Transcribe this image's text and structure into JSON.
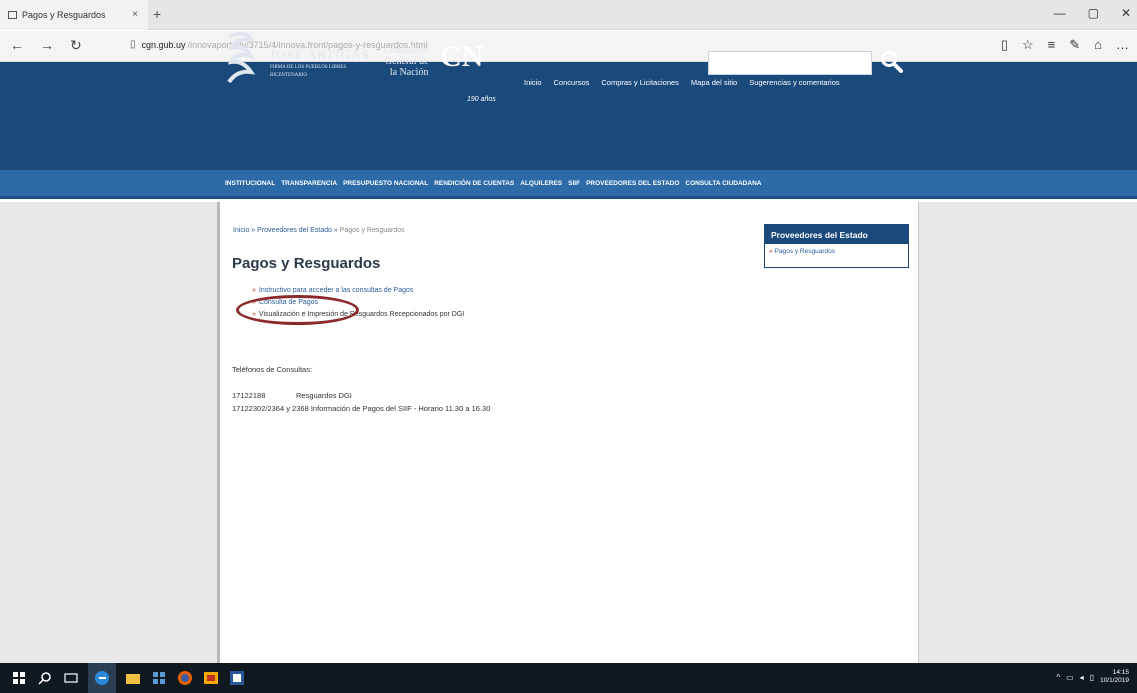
{
  "browser": {
    "tab_title": "Pagos y Resguardos",
    "tab_close": "×",
    "new_tab": "+",
    "url_host": "cgn.gub.uy",
    "url_path": "/innovaportal/v/3715/4/innova.front/pagos-y-resguardos.html"
  },
  "header": {
    "top_links": [
      "Inicio",
      "Concursos",
      "Compras y Licitaciones",
      "Mapa del sitio",
      "Sugerencias y comentarios"
    ],
    "artigas_name": "JOSÉ ARTIGAS",
    "artigas_sub1": "FIRMA DE LOS PUEBLOS LIBRES",
    "artigas_sub2": "BICENTENARIO",
    "cgn_line1": "Contaduría",
    "cgn_line2": "General de",
    "cgn_line3": "la Nación",
    "cgn_logo": "CN",
    "anos": "190 años",
    "search_value": ""
  },
  "mainnav": [
    "INSTITUCIONAL",
    "TRANSPARENCIA",
    "PRESUPUESTO NACIONAL",
    "RENDICIÓN DE CUENTAS",
    "ALQUILERES",
    "SIIF",
    "PROVEEDORES DEL ESTADO",
    "CONSULTA CIUDADANA"
  ],
  "main": {
    "breadcrumb_home": "Inicio",
    "breadcrumb_sep": "»",
    "breadcrumb_section": "Proveedores del Estado",
    "breadcrumb_current": "Pagos y Resguardos",
    "title": "Pagos y Resguardos",
    "links": [
      "Instructivo para acceder a las consultas de Pagos",
      "Consulta de Pagos",
      "Visualización e Impresión de Resguardos Recepcionados por DGI"
    ],
    "bullet": "»",
    "tel_title": "Teléfonos de Consultas:",
    "tel1_num": "17122188",
    "tel1_desc": "Resguardos DGI",
    "tel2": "17122302/2364 y 2368 Información de Pagos del SIIF - Horario 11.30 a 16.30"
  },
  "sidebox": {
    "heading": "Proveedores del Estado",
    "item": "Pagos y Resguardos"
  },
  "taskbar": {
    "time": "14:15",
    "date": "10/1/2019"
  }
}
